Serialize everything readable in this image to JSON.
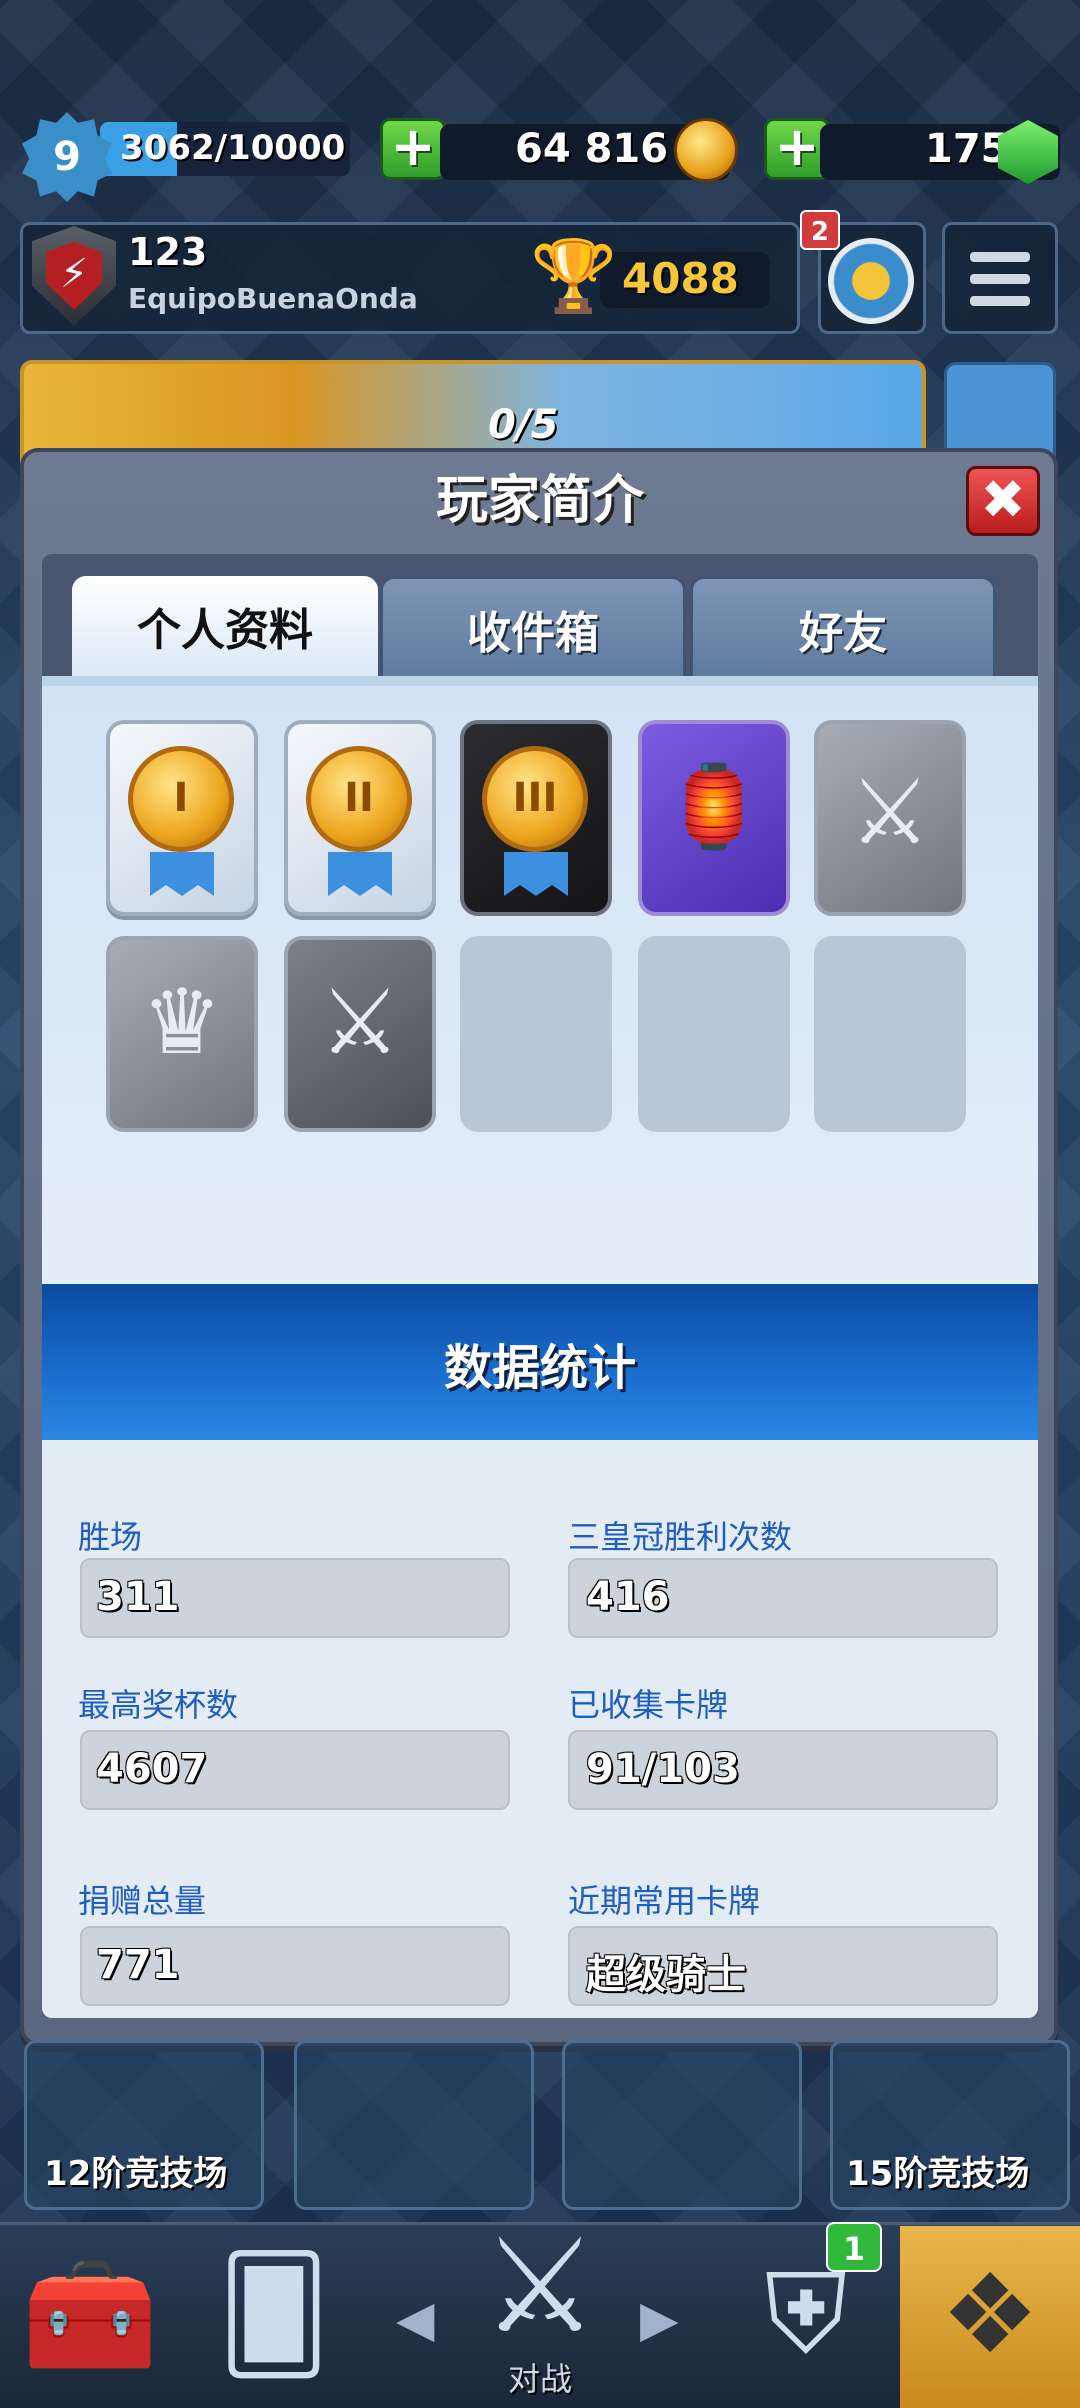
{
  "header": {
    "level": "9",
    "xp": "3062/10000",
    "xp_progress": 0.306,
    "gold": "64 816",
    "gems": "175",
    "clan_number": "123",
    "clan_name": "EquipoBuenaOnda",
    "trophies": "4088",
    "notification_count": "2",
    "banner_progress": "0/5"
  },
  "modal": {
    "title": "玩家简介",
    "close_glyph": "✖",
    "tabs": [
      "个人资料",
      "收件箱",
      "好友"
    ],
    "badges": [
      {
        "icon": "medal-1-icon",
        "label": "I"
      },
      {
        "icon": "medal-2-icon",
        "label": "II"
      },
      {
        "icon": "medal-3-icon",
        "label": "III"
      },
      {
        "icon": "chest-badge-icon"
      },
      {
        "icon": "sword-wreath-icon"
      },
      {
        "icon": "crown-icon"
      },
      {
        "icon": "crossed-swords-shield-icon"
      }
    ],
    "stats_title": "数据统计",
    "stats": {
      "wins_label": "胜场",
      "wins": "311",
      "three_crown_label": "三皇冠胜利次数",
      "three_crown": "416",
      "best_trophies_label": "最高奖杯数",
      "best_trophies": "4607",
      "cards_found_label": "已收集卡牌",
      "cards_found": "91/103",
      "donations_label": "捐赠总量",
      "donations": "771",
      "fav_card_label": "近期常用卡牌",
      "fav_card": "超级骑士"
    }
  },
  "arena": {
    "left_label": "12阶竞技场",
    "right_label": "15阶竞技场"
  },
  "bottom_nav": {
    "battle_label": "对战",
    "clan_badge": "1"
  },
  "colors": {
    "stat_label": "#1f5dbf",
    "tab_active_bg": "#ffffff",
    "stats_header": "#1c6fd0",
    "close_red": "#d32b2b"
  }
}
